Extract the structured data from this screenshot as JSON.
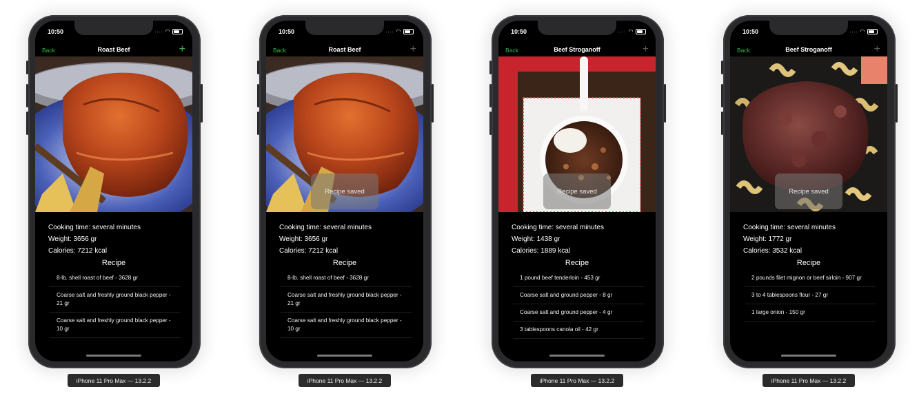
{
  "device_label": "iPhone 11 Pro Max — 13.2.2",
  "status": {
    "time": "10:50"
  },
  "nav": {
    "back_label": "Back",
    "plus_icon": "+"
  },
  "info_labels": {
    "cooking": "Cooking time: several minutes",
    "recipe_heading": "Recipe"
  },
  "toast": "Recipe saved",
  "colors": {
    "accent": "#2fbf45",
    "background": "#000000",
    "device": "#2a2a2c"
  },
  "screens": [
    {
      "title": "Roast Beef",
      "weight": "Weight: 3656 gr",
      "calories": "Calories: 7212 kcal",
      "toast_visible": false,
      "plus_active": true,
      "ingredients": [
        "8-lb. shell roast of beef - 3628 gr",
        "Coarse salt and freshly ground black pepper - 21 gr",
        "Coarse salt and freshly ground black pepper - 10 gr"
      ]
    },
    {
      "title": "Roast Beef",
      "weight": "Weight: 3656 gr",
      "calories": "Calories: 7212 kcal",
      "toast_visible": true,
      "plus_active": false,
      "ingredients": [
        "8-lb. shell roast of beef - 3628 gr",
        "Coarse salt and freshly ground black pepper - 21 gr",
        "Coarse salt and freshly ground black pepper - 10 gr"
      ]
    },
    {
      "title": "Beef Stroganoff",
      "weight": "Weight: 1438 gr",
      "calories": "Calories: 1889 kcal",
      "toast_visible": true,
      "plus_active": false,
      "ingredients": [
        "1 pound beef tenderloin - 453 gr",
        "Coarse salt and ground pepper - 8 gr",
        "Coarse salt and ground pepper - 4 gr",
        "3 tablespoons canola oil - 42 gr"
      ]
    },
    {
      "title": "Beef Stroganoff",
      "weight": "Weight: 1772 gr",
      "calories": "Calories: 3532 kcal",
      "toast_visible": true,
      "plus_active": false,
      "ingredients": [
        "2 pounds filet mignon or beef sirloin - 907 gr",
        "3 to 4 tablespoons flour - 27 gr",
        "1 large onion - 150 gr"
      ]
    }
  ]
}
